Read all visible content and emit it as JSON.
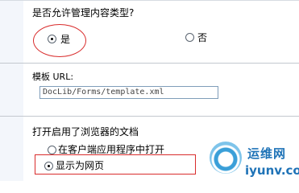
{
  "content_type": {
    "question": "是否允许管理内容类型?",
    "options": [
      {
        "label": "是",
        "checked": true
      },
      {
        "label": "否",
        "checked": false
      }
    ]
  },
  "template": {
    "label": "模板 URL:",
    "value": "DocLib/Forms/template.xml"
  },
  "browser_docs": {
    "question": "打开启用了浏览器的文档",
    "options": [
      {
        "label": "在客户端应用程序中打开",
        "checked": false
      },
      {
        "label": "显示为网页",
        "checked": true
      }
    ]
  },
  "watermark": {
    "brand": "运维网",
    "domain": "iyunv.com"
  }
}
